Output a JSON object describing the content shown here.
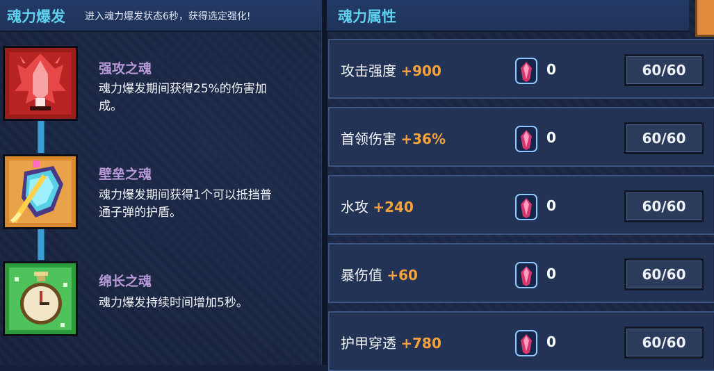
{
  "left_panel": {
    "title": "魂力爆发",
    "subtitle": "进入魂力爆发状态6秒，获得选定强化!",
    "skills": [
      {
        "name": "强攻之魂",
        "desc_line1": "魂力爆发期间获得25%的伤害加",
        "desc_line2": "成。",
        "icon": "red-flame-soul-icon",
        "color": "#d23a3a"
      },
      {
        "name": "壁垒之魂",
        "desc_line1": "魂力爆发期间获得1个可以抵挡普",
        "desc_line2": "通子弹的护盾。",
        "icon": "shield-sword-soul-icon",
        "color": "#e59b36"
      },
      {
        "name": "绵长之魂",
        "desc_line1": "魂力爆发持续时间增加5秒。",
        "desc_line2": "",
        "icon": "stopwatch-soul-icon",
        "color": "#3fbf4f"
      }
    ]
  },
  "right_panel": {
    "title": "魂力属性",
    "stats": [
      {
        "label": "攻击强度",
        "bonus": "+900",
        "gems": "0",
        "level": "60/60"
      },
      {
        "label": "首领伤害",
        "bonus": "+36%",
        "gems": "0",
        "level": "60/60"
      },
      {
        "label": "水攻",
        "bonus": "+240",
        "gems": "0",
        "level": "60/60"
      },
      {
        "label": "暴伤值",
        "bonus": "+60",
        "gems": "0",
        "level": "60/60"
      },
      {
        "label": "护甲穿透",
        "bonus": "+780",
        "gems": "0",
        "level": "60/60"
      }
    ]
  },
  "colors": {
    "title_cyan": "#5ed0ee",
    "skill_name_purple": "#b99ad8",
    "bonus_orange": "#f6a23a",
    "panel_bg": "#17213b"
  }
}
